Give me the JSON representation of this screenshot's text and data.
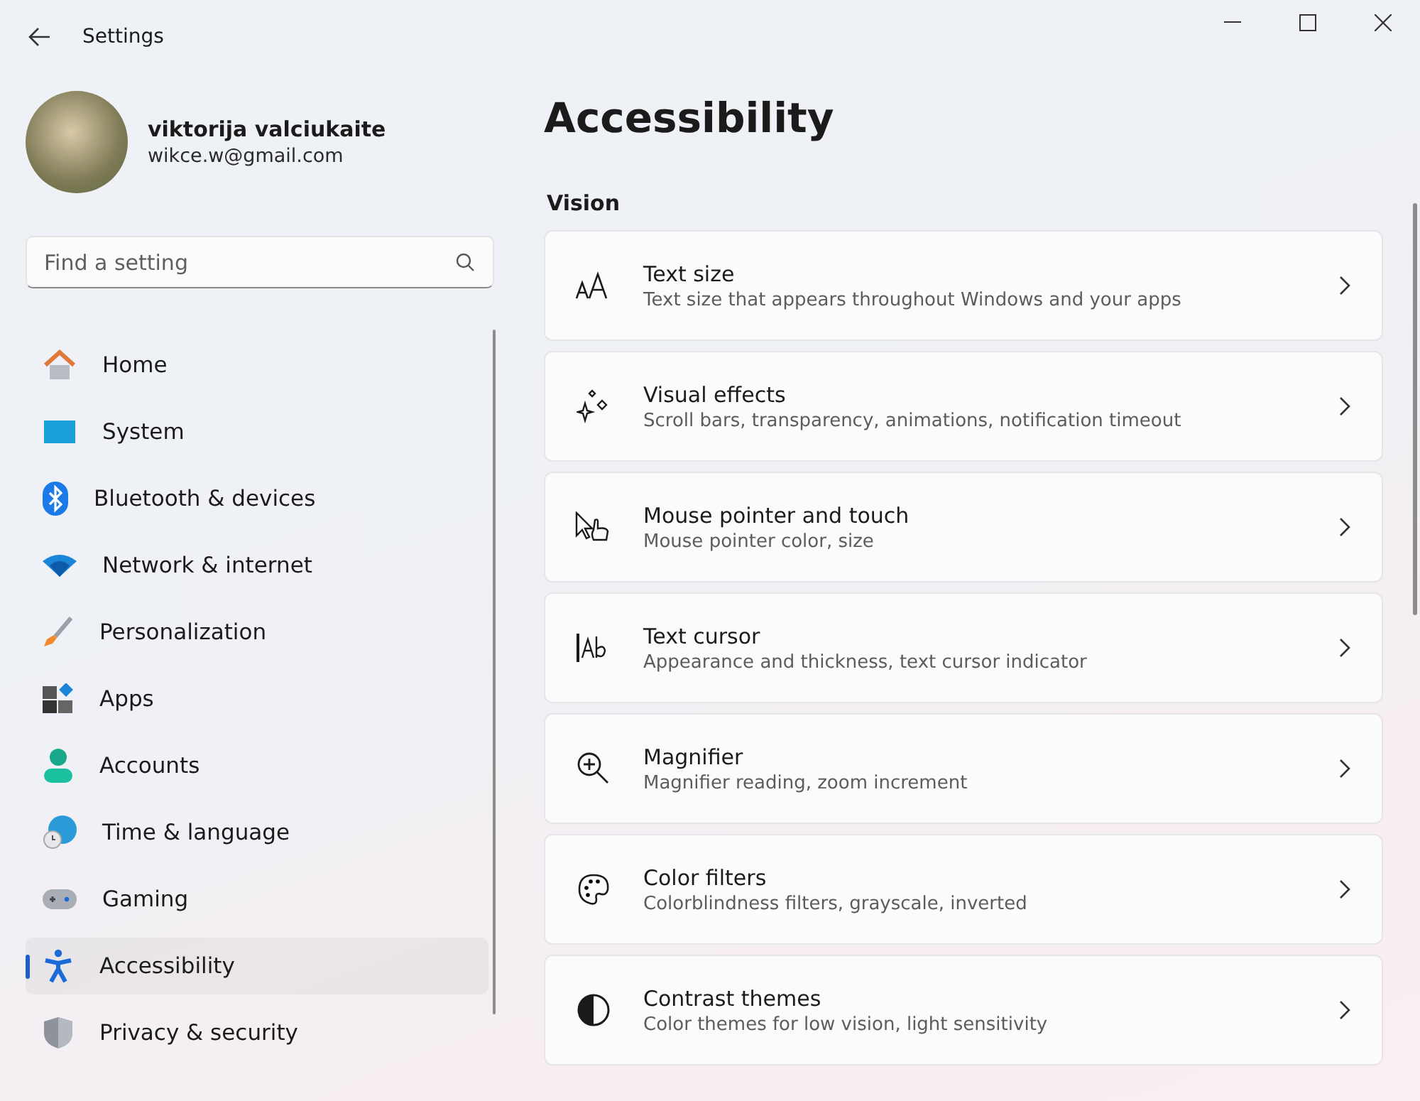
{
  "window": {
    "title": "Settings"
  },
  "profile": {
    "name": "viktorija valciukaite",
    "email": "wikce.w@gmail.com"
  },
  "search": {
    "placeholder": "Find a setting"
  },
  "nav": [
    {
      "label": "Home",
      "selected": false
    },
    {
      "label": "System",
      "selected": false
    },
    {
      "label": "Bluetooth & devices",
      "selected": false
    },
    {
      "label": "Network & internet",
      "selected": false
    },
    {
      "label": "Personalization",
      "selected": false
    },
    {
      "label": "Apps",
      "selected": false
    },
    {
      "label": "Accounts",
      "selected": false
    },
    {
      "label": "Time & language",
      "selected": false
    },
    {
      "label": "Gaming",
      "selected": false
    },
    {
      "label": "Accessibility",
      "selected": true
    },
    {
      "label": "Privacy & security",
      "selected": false
    }
  ],
  "page": {
    "title": "Accessibility",
    "section": "Vision"
  },
  "cards": [
    {
      "title": "Text size",
      "subtitle": "Text size that appears throughout Windows and your apps"
    },
    {
      "title": "Visual effects",
      "subtitle": "Scroll bars, transparency, animations, notification timeout"
    },
    {
      "title": "Mouse pointer and touch",
      "subtitle": "Mouse pointer color, size"
    },
    {
      "title": "Text cursor",
      "subtitle": "Appearance and thickness, text cursor indicator"
    },
    {
      "title": "Magnifier",
      "subtitle": "Magnifier reading, zoom increment"
    },
    {
      "title": "Color filters",
      "subtitle": "Colorblindness filters, grayscale, inverted"
    },
    {
      "title": "Contrast themes",
      "subtitle": "Color themes for low vision, light sensitivity"
    }
  ]
}
